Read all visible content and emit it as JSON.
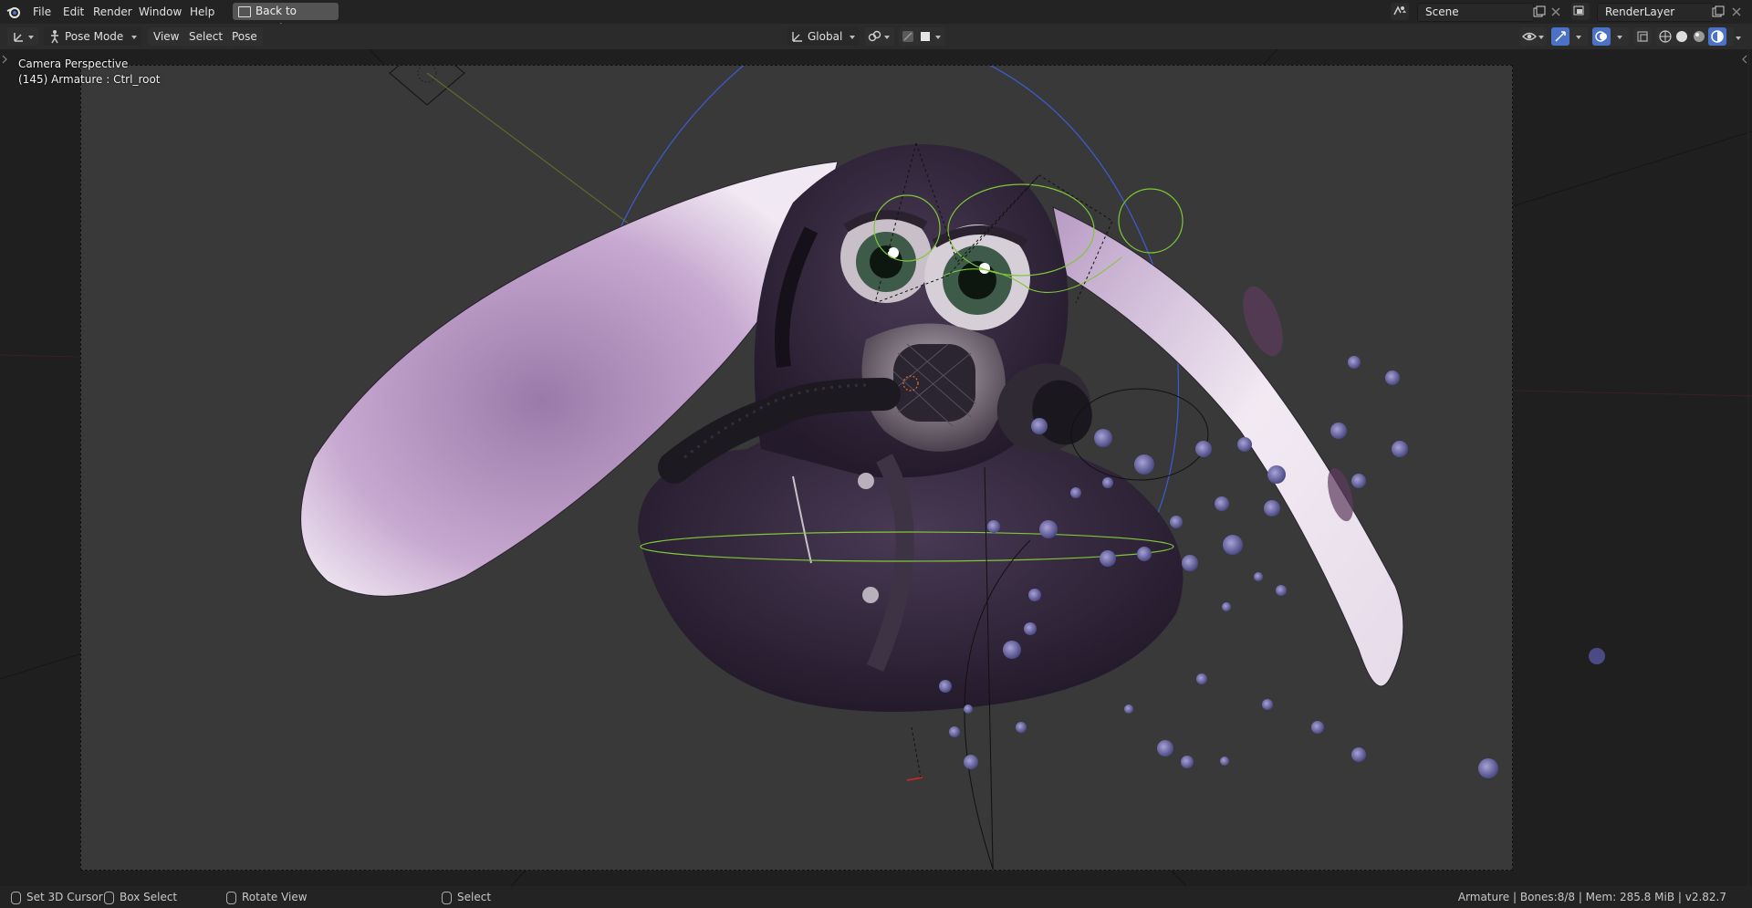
{
  "topbar": {
    "menus": [
      "File",
      "Edit",
      "Render",
      "Window",
      "Help"
    ],
    "back_button": "Back to Previous",
    "scene_field": "Scene",
    "view_layer_field": "RenderLayer"
  },
  "viewport_header": {
    "mode": "Pose Mode",
    "menus": [
      "View",
      "Select",
      "Pose"
    ],
    "orientation": "Global"
  },
  "viewport": {
    "camera_label": "Camera Perspective",
    "object_label": "(145) Armature : Ctrl_root",
    "accent_color": "#4b72c4",
    "rig_color": "#7ec837"
  },
  "statusbar": {
    "left_click": "Set 3D Cursor",
    "drag": "Box Select",
    "middle": "Rotate View",
    "right": "Select",
    "info": "Armature | Bones:8/8 | Mem: 285.8 MiB | v2.82.7"
  }
}
